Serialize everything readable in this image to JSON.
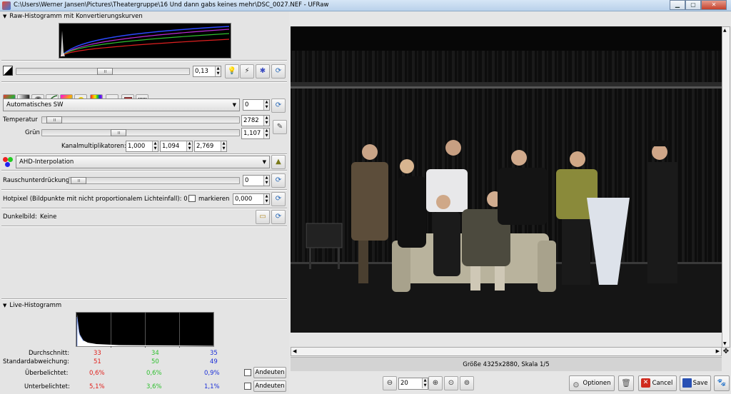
{
  "window": {
    "title": "C:\\Users\\Werner Jansen\\Pictures\\Theatergruppe\\16 Und dann gabs keines mehr\\DSC_0027.NEF - UFRaw"
  },
  "raw_histogram": {
    "title": "Raw-Histogramm mit Konvertierungskurven"
  },
  "exposure": {
    "value": "0,13"
  },
  "white_balance": {
    "preset": "Automatisches SW",
    "fine_tune": "0",
    "temperature_label": "Temperatur",
    "temperature": "2782",
    "green_label": "Grün",
    "green": "1,107",
    "multipliers_label": "Kanalmultiplikatoren:",
    "multipliers": [
      "1,000",
      "1,094",
      "2,769"
    ]
  },
  "interpolation": {
    "value": "AHD-Interpolation"
  },
  "denoise": {
    "label": "Rauschunterdrückung",
    "value": "0"
  },
  "hotpixel": {
    "label": "Hotpixel (Bildpunkte mit nicht proportionalem Lichteinfall): 0",
    "mark_label": "markieren",
    "value": "0,000"
  },
  "darkframe": {
    "label": "Dunkelbild:",
    "value": "Keine"
  },
  "live_histogram": {
    "title": "Live-Histogramm",
    "avg_label": "Durchschnitt:",
    "avg": [
      "33",
      "34",
      "35"
    ],
    "std_label": "Standardabweichung:",
    "std": [
      "51",
      "50",
      "49"
    ],
    "over_label": "Überbelichtet:",
    "over": [
      "0,6%",
      "0,6%",
      "0,9%"
    ],
    "under_label": "Unterbelichtet:",
    "under": [
      "5,1%",
      "3,6%",
      "1,1%"
    ],
    "show_label": "Andeuten",
    "colors": {
      "r": "#e0201c",
      "g": "#2fc02f",
      "b": "#1b2fd8"
    }
  },
  "status": {
    "text": "Größe 4325x2880, Skala 1/5"
  },
  "zoom": {
    "value": "20"
  },
  "buttons": {
    "options": "Optionen",
    "cancel": "Cancel",
    "save": "Save"
  }
}
